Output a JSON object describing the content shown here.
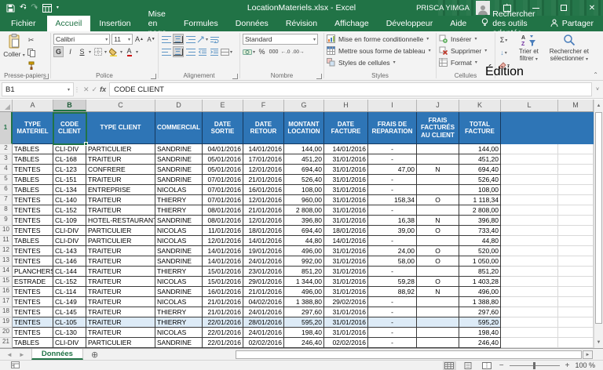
{
  "titlebar": {
    "title": "LocationMateriels.xlsx - Excel",
    "user_name": "PRISCA YIMGA"
  },
  "menu": {
    "file": "Fichier",
    "tabs": [
      "Accueil",
      "Insertion",
      "Mise en page",
      "Formules",
      "Données",
      "Révision",
      "Affichage",
      "Développeur",
      "Aide"
    ],
    "active_tab": "Accueil",
    "tell_me": "Rechercher des outils adaptés",
    "share": "Partager"
  },
  "ribbon": {
    "group_clipboard": "Presse-papiers",
    "paste_label": "Coller",
    "group_font": "Police",
    "font_name": "Calibri",
    "font_size": "11",
    "bold_label": "G",
    "italic_label": "I",
    "underline_label": "S",
    "group_alignment": "Alignement",
    "group_number": "Nombre",
    "number_format": "Standard",
    "group_styles": "Styles",
    "styles_items": [
      "Mise en forme conditionnelle",
      "Mettre sous forme de tableau",
      "Styles de cellules"
    ],
    "group_cells": "Cellules",
    "cells_items": [
      "Insérer",
      "Supprimer",
      "Format"
    ],
    "group_editing": "Édition",
    "sort_filter_label": "Trier et filtrer",
    "find_select_label": "Rechercher et sélectionner"
  },
  "icons": {
    "undo": "↶",
    "redo": "↷",
    "scissors": "✂",
    "autosum": "Σ",
    "fill_down": "↓",
    "percent": "%",
    "thousands": "000",
    "dropdown": "▾",
    "up_small": "▴",
    "cancel": "✕",
    "check": "✓",
    "fx": "fx",
    "dots": "⋮",
    "expand": "˅",
    "grow_font": "A",
    "shrink_font": "A",
    "new_sheet": "⊕",
    "nav_left": "◄",
    "nav_right": "►",
    "scroll_up": "▲",
    "scroll_down": "▼",
    "minus": "−",
    "plus": "+",
    "close": "✕",
    "collapse_ribbon": "⌃"
  },
  "formula_bar": {
    "name_box": "B1",
    "value": "CODE CLIENT"
  },
  "sheet": {
    "column_letters": [
      "A",
      "B",
      "C",
      "D",
      "E",
      "F",
      "G",
      "H",
      "I",
      "J",
      "K",
      "L",
      "M"
    ],
    "selected_column": "B",
    "selected_cell": "B1",
    "header_row_number": 1,
    "header_labels": [
      "TYPE MATERIEL",
      "CODE CLIENT",
      "TYPE CLIENT",
      "COMMERCIAL",
      "DATE SORTIE",
      "DATE RETOUR",
      "MONTANT LOCATION",
      "DATE FACTURE",
      "FRAIS DE REPARATION",
      "FRAIS FACTURÉS AU CLIENT",
      "TOTAL FACTURE"
    ],
    "highlighted_row": 19,
    "rows": [
      {
        "n": 2,
        "cells": [
          "TABLES",
          "CLI-DIV",
          "PARTICULIER",
          "SANDRINE",
          "04/01/2016",
          "14/01/2016",
          "144,00",
          "14/01/2016",
          "-",
          "",
          "144,00"
        ]
      },
      {
        "n": 3,
        "cells": [
          "TABLES",
          "CL-168",
          "TRAITEUR",
          "SANDRINE",
          "05/01/2016",
          "17/01/2016",
          "451,20",
          "31/01/2016",
          "-",
          "",
          "451,20"
        ]
      },
      {
        "n": 4,
        "cells": [
          "TENTES",
          "CL-123",
          "CONFRERE",
          "SANDRINE",
          "05/01/2016",
          "12/01/2016",
          "694,40",
          "31/01/2016",
          "47,00",
          "N",
          "694,40"
        ]
      },
      {
        "n": 5,
        "cells": [
          "TABLES",
          "CL-151",
          "TRAITEUR",
          "SANDRINE",
          "07/01/2016",
          "21/01/2016",
          "526,40",
          "31/01/2016",
          "-",
          "",
          "526,40"
        ]
      },
      {
        "n": 6,
        "cells": [
          "TABLES",
          "CL-134",
          "ENTREPRISE",
          "NICOLAS",
          "07/01/2016",
          "16/01/2016",
          "108,00",
          "31/01/2016",
          "-",
          "",
          "108,00"
        ]
      },
      {
        "n": 7,
        "cells": [
          "TENTES",
          "CL-140",
          "TRAITEUR",
          "THIERRY",
          "07/01/2016",
          "12/01/2016",
          "960,00",
          "31/01/2016",
          "158,34",
          "O",
          "1 118,34"
        ]
      },
      {
        "n": 8,
        "cells": [
          "TENTES",
          "CL-152",
          "TRAITEUR",
          "THIERRY",
          "08/01/2016",
          "21/01/2016",
          "2 808,00",
          "31/01/2016",
          "-",
          "",
          "2 808,00"
        ]
      },
      {
        "n": 9,
        "cells": [
          "TENTES",
          "CL-109",
          "HOTEL-RESTAURANT",
          "SANDRINE",
          "08/01/2016",
          "12/01/2016",
          "396,80",
          "31/01/2016",
          "16,38",
          "N",
          "396,80"
        ]
      },
      {
        "n": 10,
        "cells": [
          "TENTES",
          "CLI-DIV",
          "PARTICULIER",
          "NICOLAS",
          "11/01/2016",
          "18/01/2016",
          "694,40",
          "18/01/2016",
          "39,00",
          "O",
          "733,40"
        ]
      },
      {
        "n": 11,
        "cells": [
          "TABLES",
          "CLI-DIV",
          "PARTICULIER",
          "NICOLAS",
          "12/01/2016",
          "14/01/2016",
          "44,80",
          "14/01/2016",
          "-",
          "",
          "44,80"
        ]
      },
      {
        "n": 12,
        "cells": [
          "TENTES",
          "CL-143",
          "TRAITEUR",
          "SANDRINE",
          "14/01/2016",
          "19/01/2016",
          "496,00",
          "31/01/2016",
          "24,00",
          "O",
          "520,00"
        ]
      },
      {
        "n": 13,
        "cells": [
          "TENTES",
          "CL-146",
          "TRAITEUR",
          "SANDRINE",
          "14/01/2016",
          "24/01/2016",
          "992,00",
          "31/01/2016",
          "58,00",
          "O",
          "1 050,00"
        ]
      },
      {
        "n": 14,
        "cells": [
          "PLANCHERS",
          "CL-144",
          "TRAITEUR",
          "THIERRY",
          "15/01/2016",
          "23/01/2016",
          "851,20",
          "31/01/2016",
          "-",
          "",
          "851,20"
        ]
      },
      {
        "n": 15,
        "cells": [
          "ESTRADE",
          "CL-152",
          "TRAITEUR",
          "NICOLAS",
          "15/01/2016",
          "29/01/2016",
          "1 344,00",
          "31/01/2016",
          "59,28",
          "O",
          "1 403,28"
        ]
      },
      {
        "n": 16,
        "cells": [
          "TENTES",
          "CL-114",
          "TRAITEUR",
          "SANDRINE",
          "16/01/2016",
          "21/01/2016",
          "496,00",
          "31/01/2016",
          "88,92",
          "N",
          "496,00"
        ]
      },
      {
        "n": 17,
        "cells": [
          "TENTES",
          "CL-149",
          "TRAITEUR",
          "NICOLAS",
          "21/01/2016",
          "04/02/2016",
          "1 388,80",
          "29/02/2016",
          "-",
          "",
          "1 388,80"
        ]
      },
      {
        "n": 18,
        "cells": [
          "TENTES",
          "CL-145",
          "TRAITEUR",
          "THIERRY",
          "21/01/2016",
          "24/01/2016",
          "297,60",
          "31/01/2016",
          "-",
          "",
          "297,60"
        ]
      },
      {
        "n": 19,
        "cells": [
          "TENTES",
          "CL-105",
          "TRAITEUR",
          "THIERRY",
          "22/01/2016",
          "28/01/2016",
          "595,20",
          "31/01/2016",
          "-",
          "",
          "595,20"
        ]
      },
      {
        "n": 20,
        "cells": [
          "TENTES",
          "CL-130",
          "TRAITEUR",
          "NICOLAS",
          "22/01/2016",
          "24/01/2016",
          "198,40",
          "31/01/2016",
          "-",
          "",
          "198,40"
        ]
      },
      {
        "n": 21,
        "cells": [
          "TABLES",
          "CLI-DIV",
          "PARTICULIER",
          "SANDRINE",
          "22/01/2016",
          "02/02/2016",
          "246,40",
          "02/02/2016",
          "-",
          "",
          "246,40"
        ]
      }
    ]
  },
  "sheet_tabs": {
    "active": "Données"
  },
  "status_bar": {
    "zoom_level": "100 %"
  },
  "colors": {
    "excel_green": "#217346",
    "header_blue": "#2E75B6",
    "highlight_row": "#DDEBF7",
    "selection_border": "#217346"
  }
}
